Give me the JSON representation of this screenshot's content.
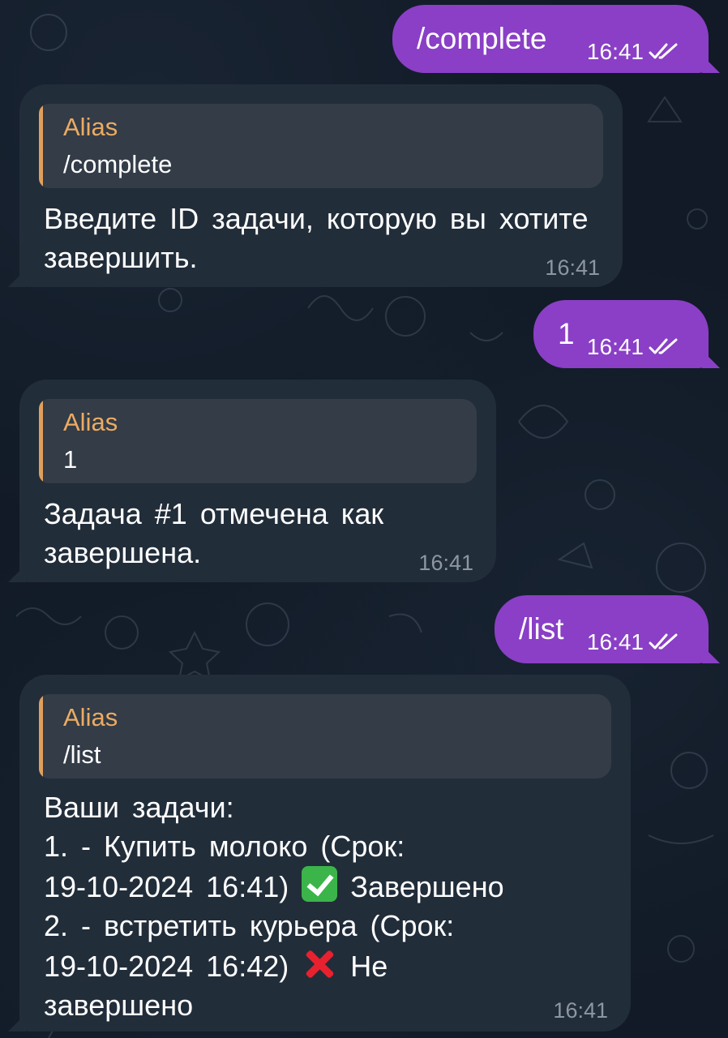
{
  "chat": {
    "messages": [
      {
        "id": "m1",
        "direction": "outgoing",
        "text": "/complete",
        "time": "16:41",
        "status": "read-double-check"
      },
      {
        "id": "m2",
        "direction": "incoming",
        "reply_to": {
          "sender": "Alias",
          "text": "/complete"
        },
        "text": "Введите ID задачи, которую вы хотите завершить.",
        "time": "16:41"
      },
      {
        "id": "m3",
        "direction": "outgoing",
        "text": "1",
        "time": "16:41",
        "status": "read-double-check"
      },
      {
        "id": "m4",
        "direction": "incoming",
        "reply_to": {
          "sender": "Alias",
          "text": "1"
        },
        "text": "Задача #1 отмечена как завершена.",
        "time": "16:41"
      },
      {
        "id": "m5",
        "direction": "outgoing",
        "text": "/list",
        "time": "16:41",
        "status": "read-double-check"
      },
      {
        "id": "m6",
        "direction": "incoming",
        "reply_to": {
          "sender": "Alias",
          "text": "/list"
        },
        "heading": "Ваши задачи:",
        "tasks": [
          {
            "line_a": "1. - Купить молоко (Срок:",
            "line_b_prefix": "19-10-2024 16:41)",
            "status_icon": "green-check-emoji",
            "status_text": "Завершено"
          },
          {
            "line_a": "2. - встретить курьера (Срок:",
            "line_b_prefix": "19-10-2024 16:42)",
            "status_icon": "red-cross-emoji",
            "status_text_a": "Не",
            "status_text_b": "завершено"
          }
        ],
        "time": "16:41"
      }
    ]
  },
  "colors": {
    "outgoing_bubble": "#8a3fc6",
    "incoming_bubble": "#222d3a",
    "reply_block": "#333c47",
    "reply_accent": "#ecab63",
    "background": "#111a26",
    "time_incoming": "#8d97a3"
  }
}
